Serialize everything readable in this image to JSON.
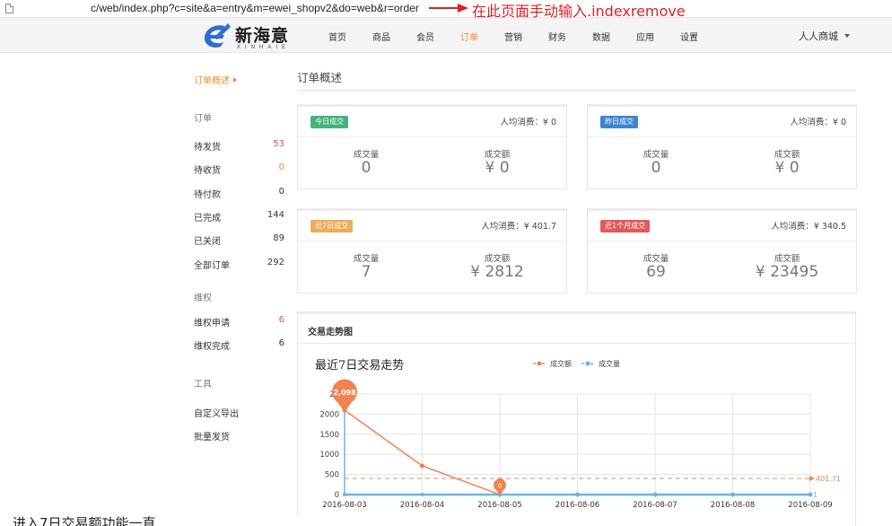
{
  "browser": {
    "url": "c/web/index.php?c=site&a=entry&m=ewei_shopv2&do=web&r=order",
    "annotation": "在此页面手动输入.indexremove",
    "annotation_color": "#e02020"
  },
  "brand": {
    "name": "新海意",
    "sub": "XINHAIE",
    "accent": "#2d6fd1"
  },
  "nav": {
    "items": [
      "首页",
      "商品",
      "会员",
      "订单",
      "营销",
      "财务",
      "数据",
      "应用",
      "设置"
    ],
    "active_index": 3,
    "store": "人人商城"
  },
  "sidebar": {
    "active_label": "订单概述",
    "groups": [
      {
        "title": "订单",
        "items": [
          {
            "label": "待发货",
            "count": "53",
            "color": "red"
          },
          {
            "label": "待收货",
            "count": "0",
            "color": "orange"
          },
          {
            "label": "待付款",
            "count": "0",
            "color": ""
          },
          {
            "label": "已完成",
            "count": "144",
            "color": ""
          },
          {
            "label": "已关闭",
            "count": "89",
            "color": ""
          },
          {
            "label": "全部订单",
            "count": "292",
            "color": ""
          }
        ]
      },
      {
        "title": "维权",
        "items": [
          {
            "label": "维权申请",
            "count": "6",
            "color": "red"
          },
          {
            "label": "维权完成",
            "count": "6",
            "color": ""
          }
        ]
      },
      {
        "title": "工具",
        "items": [
          {
            "label": "自定义导出",
            "count": "",
            "color": ""
          },
          {
            "label": "批量发货",
            "count": "",
            "color": ""
          }
        ]
      }
    ]
  },
  "main": {
    "title": "订单概述",
    "cards": [
      {
        "badge": "今日成交",
        "badge_color": "#44b27a",
        "avg": "人均消费：¥ 0",
        "qty_label": "成交量",
        "qty": "0",
        "amt_label": "成交额",
        "amt": "¥ 0"
      },
      {
        "badge": "昨日成交",
        "badge_color": "#3a86d0",
        "avg": "人均消费：¥ 0",
        "qty_label": "成交量",
        "qty": "0",
        "amt_label": "成交额",
        "amt": "¥ 0"
      },
      {
        "badge": "近7日成交",
        "badge_color": "#f0ab5a",
        "avg": "人均消费：¥ 401.7",
        "qty_label": "成交量",
        "qty": "7",
        "amt_label": "成交额",
        "amt": "¥ 2812"
      },
      {
        "badge": "近1个月成交",
        "badge_color": "#e05a5a",
        "avg": "人均消费：¥ 340.5",
        "qty_label": "成交量",
        "qty": "69",
        "amt_label": "成交额",
        "amt": "¥ 23495"
      }
    ],
    "trend_panel_title": "交易走势图"
  },
  "chart_data": {
    "type": "line",
    "title": "最近7日交易走势",
    "x": [
      "2016-08-03",
      "2016-08-04",
      "2016-08-05",
      "2016-08-06",
      "2016-08-07",
      "2016-08-08",
      "2016-08-09"
    ],
    "yticks": [
      0,
      500,
      1000,
      1500,
      2000,
      2500
    ],
    "ytick_labels": [
      "0",
      "500",
      "1000",
      "1500",
      "2000",
      "25"
    ],
    "ylim": [
      0,
      2500
    ],
    "series": [
      {
        "name": "成交额",
        "color": "#f0834f",
        "values": [
          2098,
          714,
          0,
          0,
          0,
          0,
          0
        ]
      },
      {
        "name": "成交量",
        "color": "#6fb3e8",
        "values": [
          1,
          0,
          0,
          0,
          0,
          0,
          1
        ]
      }
    ],
    "markers": [
      {
        "series": 0,
        "index": 0,
        "label": "2,098"
      },
      {
        "series": 0,
        "index": 2,
        "label": "0"
      }
    ],
    "average": {
      "value": 401.71,
      "label": "401.71",
      "color": "#f0834f"
    },
    "series1_end_label": "1",
    "grid": true,
    "legend": "top-center"
  },
  "bottom_caption": "进入7日交易额功能一直"
}
